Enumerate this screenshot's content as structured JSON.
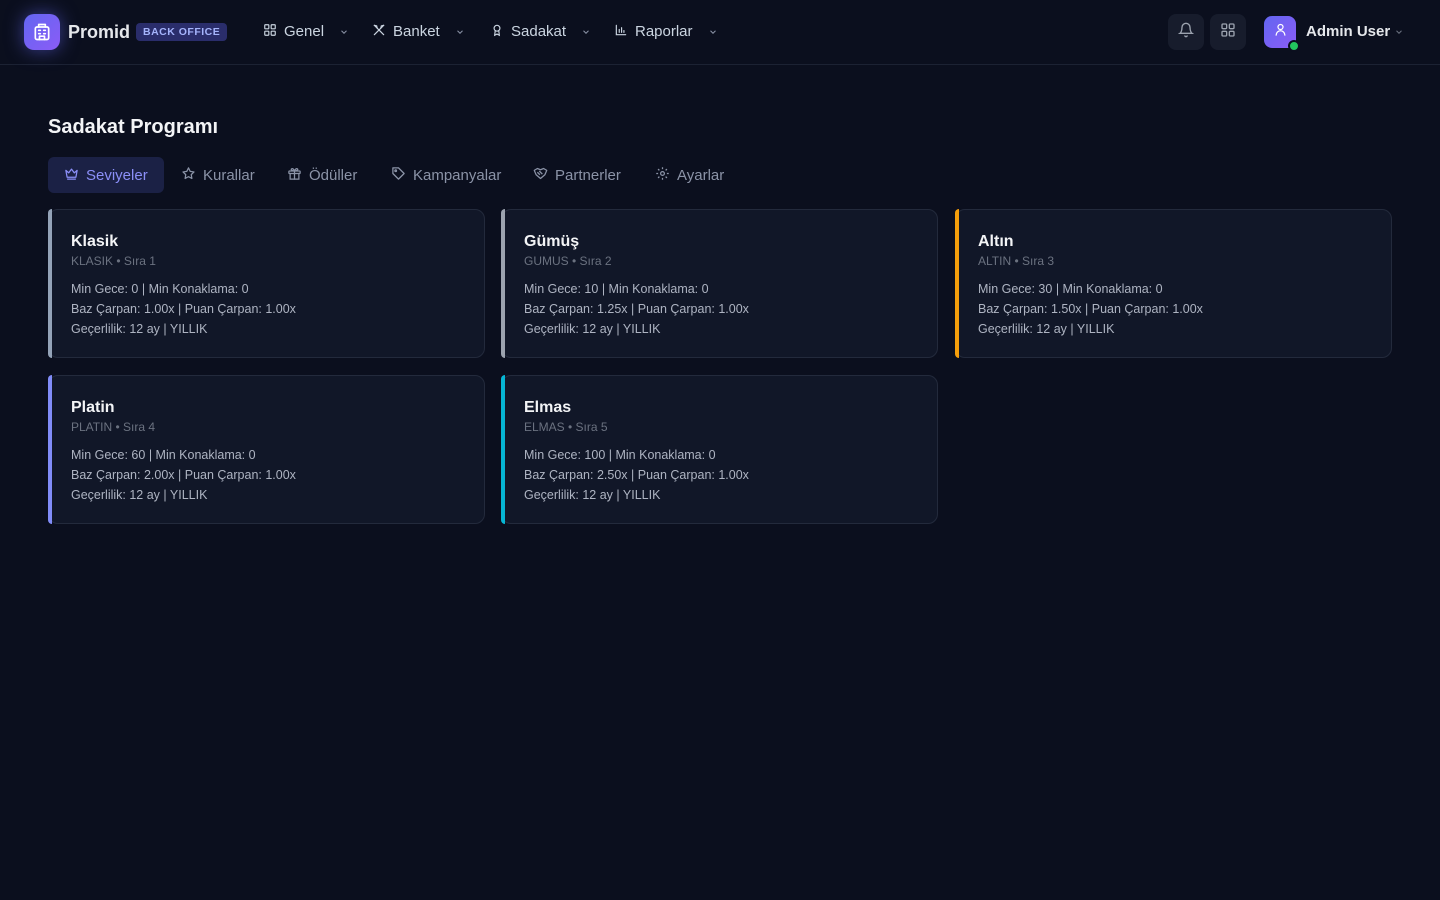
{
  "header": {
    "brand": "Promid",
    "badge": "BACK OFFICE",
    "nav": [
      {
        "label": "Genel",
        "icon": "grid-icon"
      },
      {
        "label": "Banket",
        "icon": "utensils-icon"
      },
      {
        "label": "Sadakat",
        "icon": "award-icon"
      },
      {
        "label": "Raporlar",
        "icon": "bar-chart-icon"
      }
    ],
    "user": {
      "name": "Admin User",
      "status_color": "#22c55e"
    }
  },
  "page": {
    "title": "Sadakat Programı",
    "tabs": [
      {
        "label": "Seviyeler",
        "icon": "crown-icon",
        "active": true
      },
      {
        "label": "Kurallar",
        "icon": "star-icon",
        "active": false
      },
      {
        "label": "Ödüller",
        "icon": "gift-icon",
        "active": false
      },
      {
        "label": "Kampanyalar",
        "icon": "tag-icon",
        "active": false
      },
      {
        "label": "Partnerler",
        "icon": "handshake-icon",
        "active": false
      },
      {
        "label": "Ayarlar",
        "icon": "gear-icon",
        "active": false
      }
    ]
  },
  "tiers": [
    {
      "name": "Klasik",
      "sub": "KLASIK • Sıra 1",
      "line1": "Min Gece: 0 | Min Konaklama: 0",
      "line2": "Baz Çarpan: 1.00x | Puan Çarpan: 1.00x",
      "line3": "Geçerlilik: 12 ay | YILLIK",
      "accent": "#94a3b8"
    },
    {
      "name": "Gümüş",
      "sub": "GUMUS • Sıra 2",
      "line1": "Min Gece: 10 | Min Konaklama: 0",
      "line2": "Baz Çarpan: 1.25x | Puan Çarpan: 1.00x",
      "line3": "Geçerlilik: 12 ay | YILLIK",
      "accent": "#9ca3af"
    },
    {
      "name": "Altın",
      "sub": "ALTIN • Sıra 3",
      "line1": "Min Gece: 30 | Min Konaklama: 0",
      "line2": "Baz Çarpan: 1.50x | Puan Çarpan: 1.00x",
      "line3": "Geçerlilik: 12 ay | YILLIK",
      "accent": "#f59e0b"
    },
    {
      "name": "Platin",
      "sub": "PLATIN • Sıra 4",
      "line1": "Min Gece: 60 | Min Konaklama: 0",
      "line2": "Baz Çarpan: 2.00x | Puan Çarpan: 1.00x",
      "line3": "Geçerlilik: 12 ay | YILLIK",
      "accent": "#818cf8"
    },
    {
      "name": "Elmas",
      "sub": "ELMAS • Sıra 5",
      "line1": "Min Gece: 100 | Min Konaklama: 0",
      "line2": "Baz Çarpan: 2.50x | Puan Çarpan: 1.00x",
      "line3": "Geçerlilik: 12 ay | YILLIK",
      "accent": "#06b6d4"
    }
  ]
}
